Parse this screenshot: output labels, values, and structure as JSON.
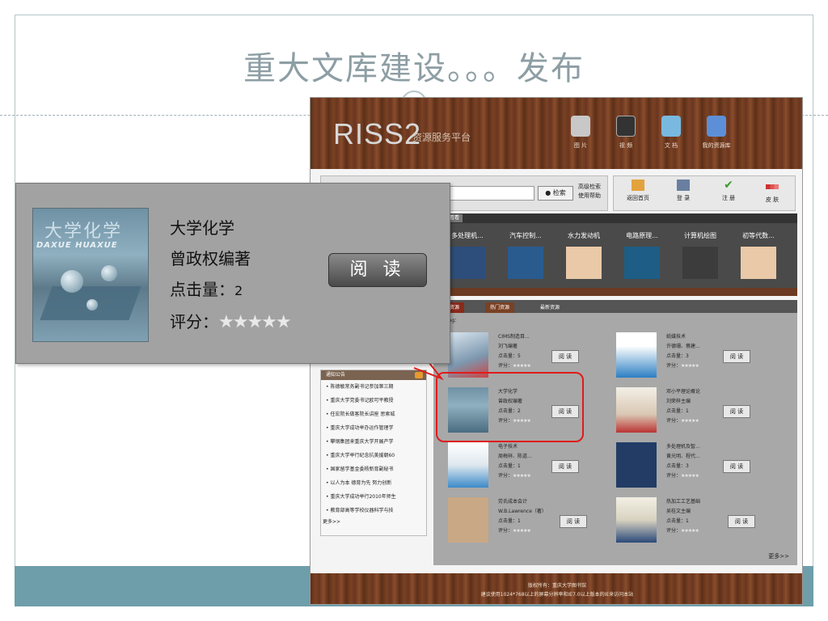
{
  "slide": {
    "title": "重大文库建设。。。发布"
  },
  "site": {
    "logo": "RISS2",
    "logo_sub": "资源服务平台",
    "nav": [
      "图 片",
      "视 频",
      "文 档",
      "我的资源库"
    ],
    "search": {
      "button": "检索",
      "advanced": "高级检索",
      "help": "使用帮助"
    },
    "toolbar": [
      "返回首页",
      "登 录",
      "注 册",
      "皮 肤"
    ],
    "recommend": {
      "tab": "推荐看看",
      "items": [
        "多处理机...",
        "汽车控制...",
        "水力发动机",
        "电路原理...",
        "计算机绘图",
        "初等代数..."
      ]
    },
    "notice": {
      "title": "通知公告",
      "items": [
        "陈德敏常务副书记参加第三期",
        "重庆大学党委书记欧可平教授",
        "任宏院长做客院长讲座 思索城",
        "重庆大学成功举办运作管理学",
        "攀钢集团来重庆大学开展产学",
        "重庆大学举行纪念抗美援朝60",
        "国家留学基金委杨新育副秘书",
        "以人为本 德育为先 努力创新",
        "重庆大学成功举行2010年师生",
        "教育部高等学校仪器科学与技"
      ],
      "more": "更多>>"
    },
    "resources": {
      "tabs": [
        "推荐资源",
        "热门资源",
        "最新资源"
      ],
      "hot_tag": "热门Tag：",
      "read_label": "阅 读",
      "stars": "★★★★★",
      "more": "更多>>",
      "books": [
        {
          "title": "CIMS制造目...",
          "author": "刘飞编著",
          "clicks": "点击量：5",
          "rating": "评分："
        },
        {
          "title": "纸媒技术",
          "author": "许德珊、蔡建...",
          "clicks": "点击量：3",
          "rating": "评分："
        },
        {
          "title": "大学化学",
          "author": "曾政权编著",
          "clicks": "点击量：2",
          "rating": "评分："
        },
        {
          "title": "邓小平理论概论",
          "author": "刘荣梓主编",
          "clicks": "点击量：1",
          "rating": "评分："
        },
        {
          "title": "电子技术",
          "author": "周梅祥、陈道...",
          "clicks": "点击量：1",
          "rating": "评分："
        },
        {
          "title": "多处理机及智...",
          "author": "黄光明、程代...",
          "clicks": "点击量：3",
          "rating": "评分："
        },
        {
          "title": "劳氏成本会计",
          "author": "W.B.Lawrence（著）",
          "clicks": "点击量：1",
          "rating": "评分："
        },
        {
          "title": "热加工工艺基础",
          "author": "吴桂文主编",
          "clicks": "点击量：1",
          "rating": "评分："
        }
      ]
    },
    "footer": {
      "line1": "版权所有：重庆大学图书馆",
      "line2": "建议使用1024*768以上的屏幕分辨率和IE7.0以上版本的IE来访问本站"
    }
  },
  "zoom": {
    "cover_title": "大学化学",
    "cover_pinyin": "DAXUE HUAXUE",
    "title": "大学化学",
    "author": "曾政权编著",
    "clicks_label": "点击量：",
    "clicks_value": "2",
    "rating_label": "评分：",
    "stars": "★★★★★",
    "read_button": "阅 读"
  },
  "colors": {
    "highlight": "#e01b1b",
    "teal_band": "#6e9ea9",
    "wood": "#6a3620"
  }
}
